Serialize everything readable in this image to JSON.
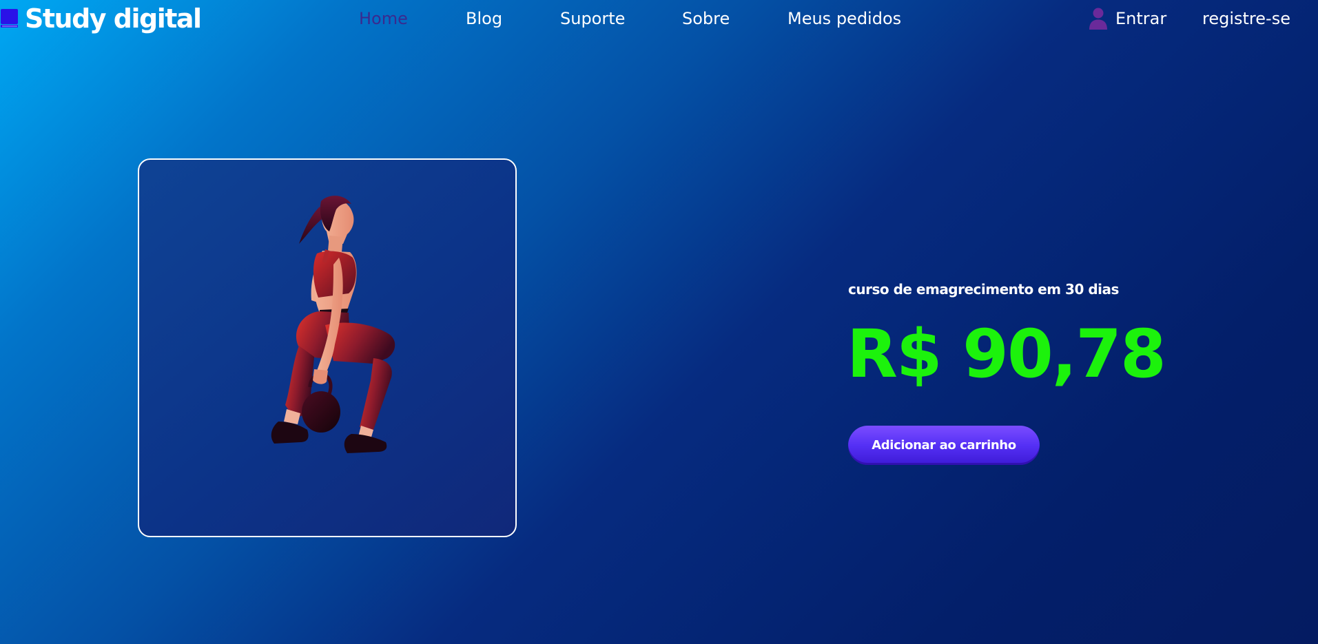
{
  "brand": {
    "name": "Study digital",
    "icon": "book-icon",
    "icon_color": "#2a12e8"
  },
  "nav": {
    "items": [
      {
        "label": "Home",
        "active": true
      },
      {
        "label": "Blog",
        "active": false
      },
      {
        "label": "Suporte",
        "active": false
      },
      {
        "label": "Sobre",
        "active": false
      },
      {
        "label": "Meus pedidos",
        "active": false
      }
    ],
    "active_color": "#3a2a8f"
  },
  "auth": {
    "login_label": "Entrar",
    "login_icon": "user-icon",
    "login_icon_color": "#6a2a9a",
    "register_label": "registre-se"
  },
  "product": {
    "image_icon": "kettlebell-squat-woman-illustration",
    "title": "curso de emagrecimento em 30 dias",
    "price": "R$ 90,78",
    "price_color": "#1cf20c",
    "cta_label": "Adicionar ao carrinho",
    "cta_color": "#5530f5"
  },
  "colors": {
    "background_start": "#00a8f3",
    "background_end": "#041b61",
    "text": "#ffffff"
  }
}
